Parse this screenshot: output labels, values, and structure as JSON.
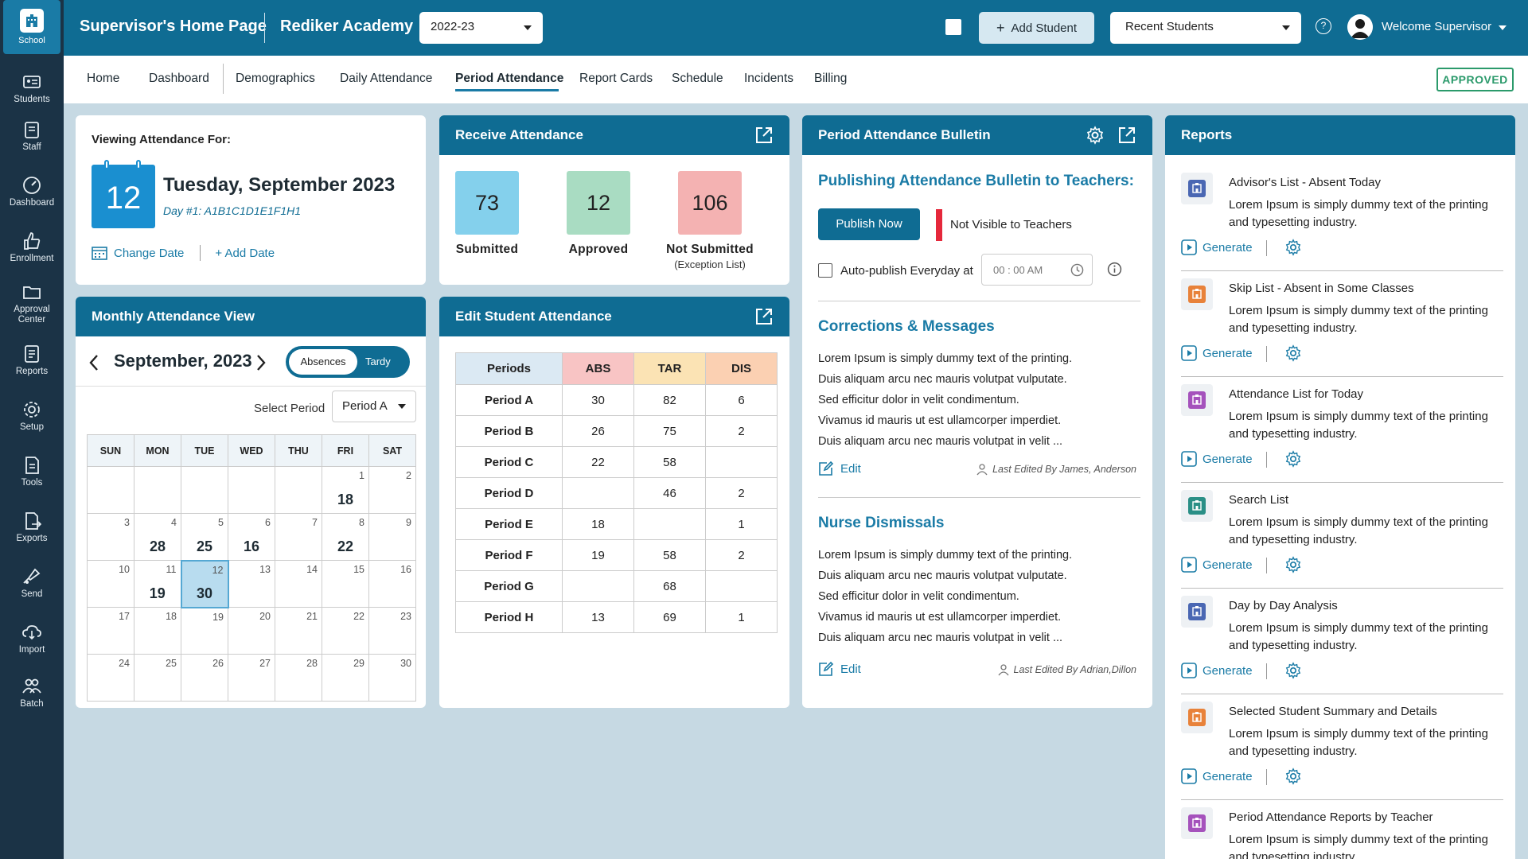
{
  "rail": {
    "school": "School",
    "items": [
      "Students",
      "Staff",
      "Dashboard",
      "Enrollment",
      "Approval Center",
      "Reports",
      "Setup",
      "Tools",
      "Exports",
      "Send",
      "Import",
      "Batch"
    ]
  },
  "topbar": {
    "title": "Supervisor's Home Page",
    "school": "Rediker Academy",
    "year": "2022-23",
    "add_student": "Add Student",
    "recent_students": "Recent Students",
    "help": "?",
    "welcome": "Welcome Supervisor"
  },
  "nav": {
    "items": [
      "Home",
      "Dashboard",
      "Demographics",
      "Daily Attendance",
      "Period Attendance",
      "Report Cards",
      "Schedule",
      "Incidents",
      "Billing"
    ],
    "status": "APPROVED"
  },
  "viewing": {
    "label": "Viewing Attendance For:",
    "day_number": "12",
    "date": "Tuesday, September 2023",
    "day_code": "Day #1: A1B1C1D1E1F1H1",
    "change_date": "Change Date",
    "add_date": "+ Add Date"
  },
  "receive": {
    "title": "Receive Attendance",
    "stats": [
      {
        "value": "73",
        "label": "Submitted",
        "color": "#84d0ec"
      },
      {
        "value": "12",
        "label": "Approved",
        "color": "#a9dcc2"
      },
      {
        "value": "106",
        "label": "Not Submitted",
        "sub": "(Exception List)",
        "color": "#f4b2b2"
      }
    ]
  },
  "bulletin": {
    "title": "Period Attendance Bulletin",
    "publishing_title": "Publishing Attendance Bulletin to Teachers:",
    "publish_now": "Publish Now",
    "not_visible": "Not Visible to Teachers",
    "auto_publish": "Auto-publish Everyday at",
    "time": "00 : 00  AM",
    "corrections_title": "Corrections & Messages",
    "corrections_body": [
      "Lorem Ipsum is simply dummy text of the printing.",
      "Duis aliquam arcu nec mauris volutpat vulputate.",
      "Sed efficitur dolor in velit condimentum.",
      "Vivamus id mauris ut est ullamcorper imperdiet.",
      "Duis aliquam arcu nec mauris volutpat in velit ..."
    ],
    "corrections_edited": "Last Edited By James, Anderson",
    "nurse_title": "Nurse Dismissals",
    "nurse_body": [
      "Lorem Ipsum is simply dummy text of the printing.",
      "Duis aliquam arcu nec mauris volutpat vulputate.",
      "Sed efficitur dolor in velit condimentum.",
      "Vivamus id mauris ut est ullamcorper imperdiet.",
      "Duis aliquam arcu nec mauris volutpat in velit ..."
    ],
    "nurse_edited": "Last Edited By Adrian,Dillon",
    "edit": "Edit"
  },
  "reports": {
    "title": "Reports",
    "generate": "Generate",
    "items": [
      {
        "title": "Advisor's List - Absent Today",
        "desc": "Lorem Ipsum is simply dummy text of the printing and typesetting industry.",
        "color": "#4a67b3"
      },
      {
        "title": "Skip List - Absent in Some Classes",
        "desc": "Lorem Ipsum is simply dummy text of the printing and typesetting industry.",
        "color": "#e8823a"
      },
      {
        "title": "Attendance List for Today",
        "desc": "Lorem Ipsum is simply dummy text of the printing and typesetting industry.",
        "color": "#a552bc"
      },
      {
        "title": "Search List",
        "desc": "Lorem Ipsum is simply dummy text of the printing and typesetting industry.",
        "color": "#2a8f86"
      },
      {
        "title": "Day by Day Analysis",
        "desc": "Lorem Ipsum is simply dummy text of the printing and typesetting industry.",
        "color": "#4a67b3"
      },
      {
        "title": "Selected Student Summary and Details",
        "desc": "Lorem Ipsum is simply dummy text of the printing and typesetting industry.",
        "color": "#e8823a"
      },
      {
        "title": "Period Attendance Reports by Teacher",
        "desc": "Lorem Ipsum is simply dummy text of the printing and typesetting industry.",
        "color": "#a552bc"
      }
    ]
  },
  "monthly": {
    "title": "Monthly Attendance View",
    "month": "September, 2023",
    "toggle_on": "Absences",
    "toggle_off": "Tardy",
    "select_label": "Select Period",
    "select_value": "Period A",
    "weekdays": [
      "SUN",
      "MON",
      "TUE",
      "WED",
      "THU",
      "FRI",
      "SAT"
    ],
    "weeks": [
      [
        {
          "d": ""
        },
        {
          "d": ""
        },
        {
          "d": ""
        },
        {
          "d": ""
        },
        {
          "d": ""
        },
        {
          "d": "1",
          "v": "18"
        },
        {
          "d": "2"
        }
      ],
      [
        {
          "d": "3"
        },
        {
          "d": "4",
          "v": "28"
        },
        {
          "d": "5",
          "v": "25"
        },
        {
          "d": "6",
          "v": "16"
        },
        {
          "d": "7"
        },
        {
          "d": "8",
          "v": "22"
        },
        {
          "d": "9"
        }
      ],
      [
        {
          "d": "10"
        },
        {
          "d": "11",
          "v": "19"
        },
        {
          "d": "12",
          "v": "30",
          "sel": true
        },
        {
          "d": "13"
        },
        {
          "d": "14"
        },
        {
          "d": "15"
        },
        {
          "d": "16"
        }
      ],
      [
        {
          "d": "17"
        },
        {
          "d": "18"
        },
        {
          "d": "19"
        },
        {
          "d": "20"
        },
        {
          "d": "21"
        },
        {
          "d": "22"
        },
        {
          "d": "23"
        }
      ],
      [
        {
          "d": "24"
        },
        {
          "d": "25"
        },
        {
          "d": "26"
        },
        {
          "d": "27"
        },
        {
          "d": "28"
        },
        {
          "d": "29"
        },
        {
          "d": "30"
        }
      ]
    ]
  },
  "edit_attendance": {
    "title": "Edit Student Attendance",
    "headers": [
      "Periods",
      "ABS",
      "TAR",
      "DIS"
    ],
    "header_colors": [
      "#dbe9f3",
      "#f8c4c4",
      "#fbe3b4",
      "#fbd0b2"
    ],
    "rows": [
      [
        "Period A",
        "30",
        "82",
        "6"
      ],
      [
        "Period B",
        "26",
        "75",
        "2"
      ],
      [
        "Period C",
        "22",
        "58",
        ""
      ],
      [
        "Period D",
        "",
        "46",
        "2"
      ],
      [
        "Period E",
        "18",
        "",
        "1"
      ],
      [
        "Period F",
        "19",
        "58",
        "2"
      ],
      [
        "Period G",
        "",
        "68",
        ""
      ],
      [
        "Period H",
        "13",
        "69",
        "1"
      ]
    ]
  }
}
